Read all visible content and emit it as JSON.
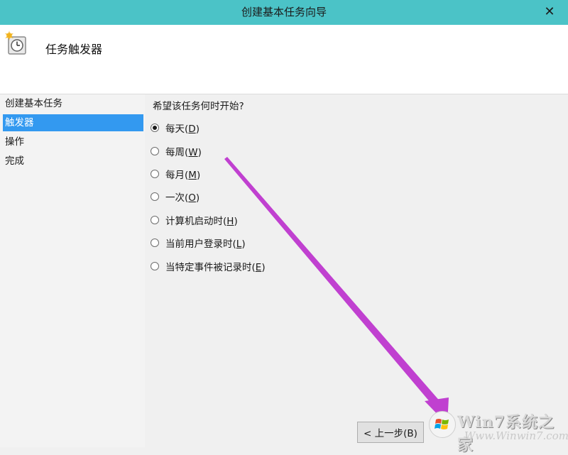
{
  "window": {
    "title": "创建基本任务向导",
    "close_glyph": "✕"
  },
  "header": {
    "title": "任务触发器",
    "icon": "task-clock-icon"
  },
  "sidebar": {
    "items": [
      {
        "label": "创建基本任务",
        "active": false
      },
      {
        "label": "触发器",
        "active": true
      },
      {
        "label": "操作",
        "active": false
      },
      {
        "label": "完成",
        "active": false
      }
    ]
  },
  "main": {
    "question": "希望该任务何时开始?",
    "options": [
      {
        "text": "每天(",
        "key": "D",
        "close": ")",
        "checked": true
      },
      {
        "text": "每周(",
        "key": "W",
        "close": ")",
        "checked": false
      },
      {
        "text": "每月(",
        "key": "M",
        "close": ")",
        "checked": false
      },
      {
        "text": "一次(",
        "key": "O",
        "close": ")",
        "checked": false
      },
      {
        "text": "计算机启动时(",
        "key": "H",
        "close": ")",
        "checked": false
      },
      {
        "text": "当前用户登录时(",
        "key": "L",
        "close": ")",
        "checked": false
      },
      {
        "text": "当特定事件被记录时(",
        "key": "E",
        "close": ")",
        "checked": false
      }
    ]
  },
  "footer": {
    "prev_button": "< 上一步(B)"
  },
  "watermark": {
    "line1": "Win7系统之家",
    "line2": "Www.Winwin7.com"
  },
  "colors": {
    "titlebar": "#4bc3c7",
    "selection": "#3399f0",
    "annotation_arrow": "#c040d0"
  }
}
